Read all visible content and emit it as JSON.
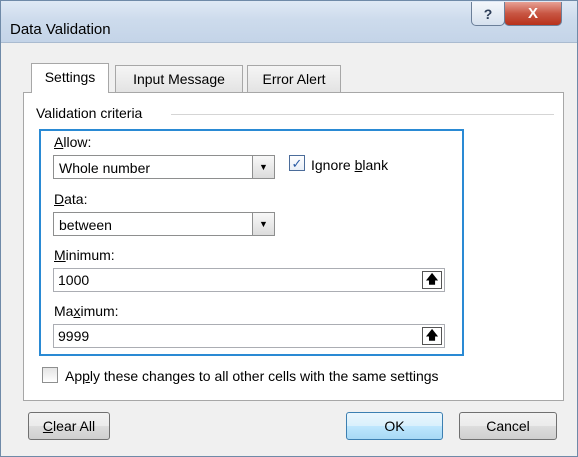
{
  "window": {
    "title": "Data Validation",
    "help_glyph": "?",
    "close_glyph": "X"
  },
  "tabs": [
    {
      "label": "Settings",
      "active": true
    },
    {
      "label": "Input Message",
      "active": false
    },
    {
      "label": "Error Alert",
      "active": false
    }
  ],
  "criteria": {
    "group_title": "Validation criteria",
    "allow": {
      "label_key": "A",
      "label_rest": "llow:",
      "value": "Whole number"
    },
    "ignore_blank": {
      "label_pre": "Ignore ",
      "label_key": "b",
      "label_rest": "lank",
      "checked": true
    },
    "data": {
      "label_key": "D",
      "label_rest": "ata:",
      "value": "between"
    },
    "minimum": {
      "label_key": "M",
      "label_rest": "inimum:",
      "value": "1000"
    },
    "maximum": {
      "label_pre": "Ma",
      "label_key": "x",
      "label_rest": "imum:",
      "value": "9999"
    }
  },
  "apply_all": {
    "label_pre": "Ap",
    "label_key": "p",
    "label_rest": "ly these changes to all other cells with the same settings",
    "checked": false
  },
  "buttons": {
    "clear_all_key": "C",
    "clear_all_rest": "lear All",
    "ok": "OK",
    "cancel": "Cancel"
  },
  "colors": {
    "highlight_border": "#2a8ad4",
    "default_button": "#bee6fd"
  }
}
